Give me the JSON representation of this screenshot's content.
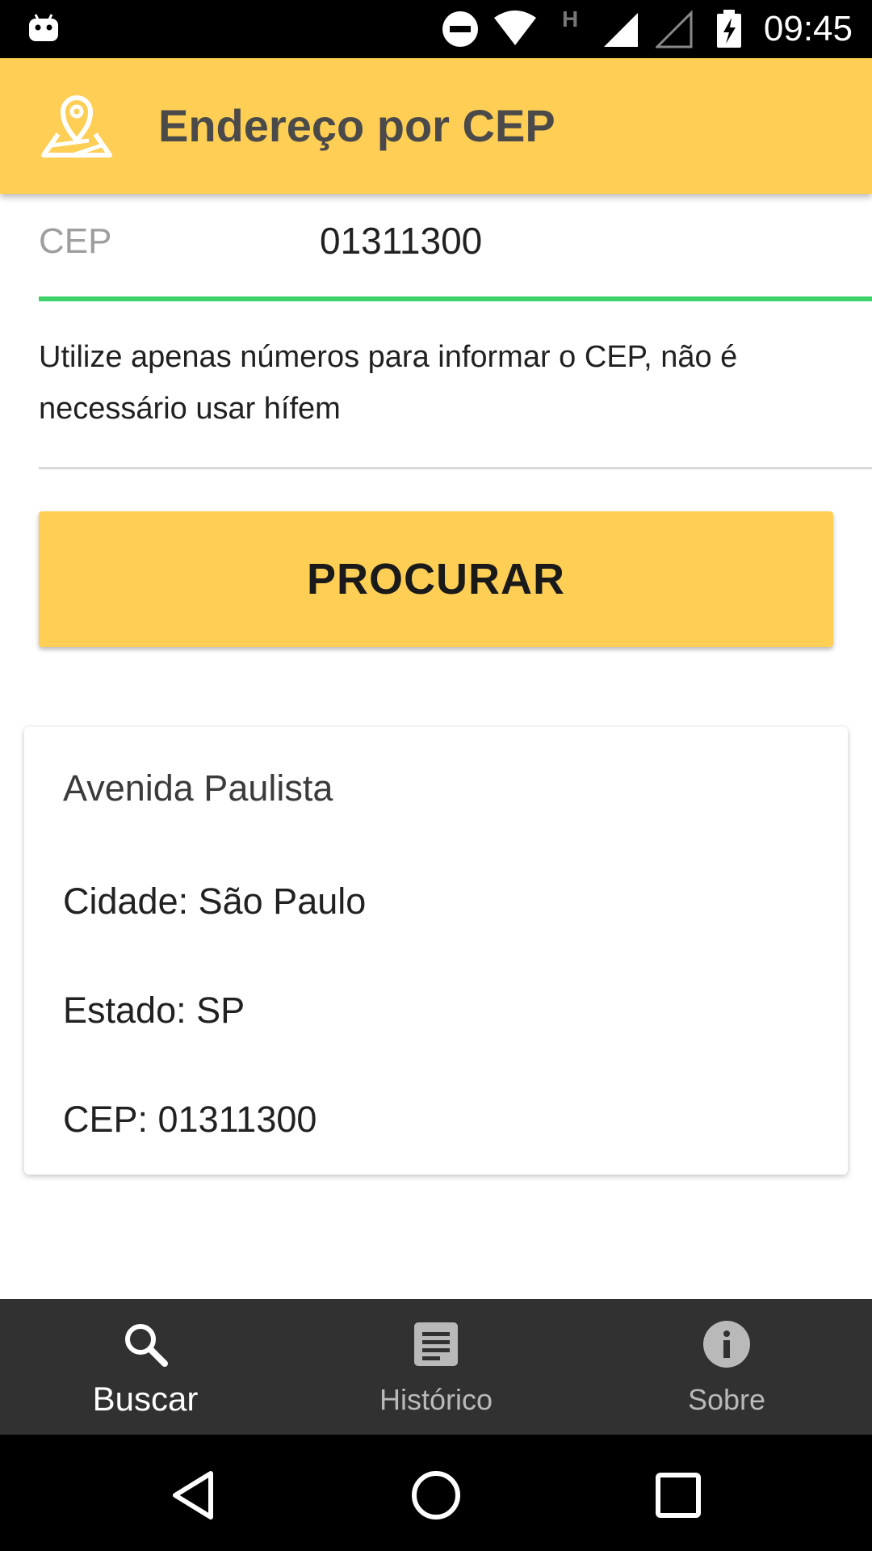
{
  "status_bar": {
    "time": "09:45",
    "network_letter": "H",
    "icons": [
      "android-debug-icon",
      "do-not-disturb-icon",
      "wifi-icon",
      "signal-icon",
      "signal-empty-icon",
      "battery-charging-icon"
    ]
  },
  "app_bar": {
    "title": "Endereço por CEP",
    "icon": "map-pin-icon",
    "color": "#FECE55"
  },
  "form": {
    "cep_label": "CEP",
    "cep_value": "01311300",
    "hint": "Utilize apenas números para informar o CEP, não é necessário usar hífem",
    "search_button": "PROCURAR",
    "focus_color": "#3DD16A"
  },
  "result": {
    "street": "Avenida Paulista",
    "city": "Cidade: São Paulo",
    "state": "Estado: SP",
    "cep": "CEP: 01311300"
  },
  "bottom_nav": {
    "items": [
      {
        "label": "Buscar",
        "icon": "search-icon",
        "active": true
      },
      {
        "label": "Histórico",
        "icon": "history-doc-icon",
        "active": false
      },
      {
        "label": "Sobre",
        "icon": "info-icon",
        "active": false
      }
    ]
  },
  "system_nav": {
    "buttons": [
      "back-icon",
      "home-icon",
      "recents-icon"
    ]
  }
}
